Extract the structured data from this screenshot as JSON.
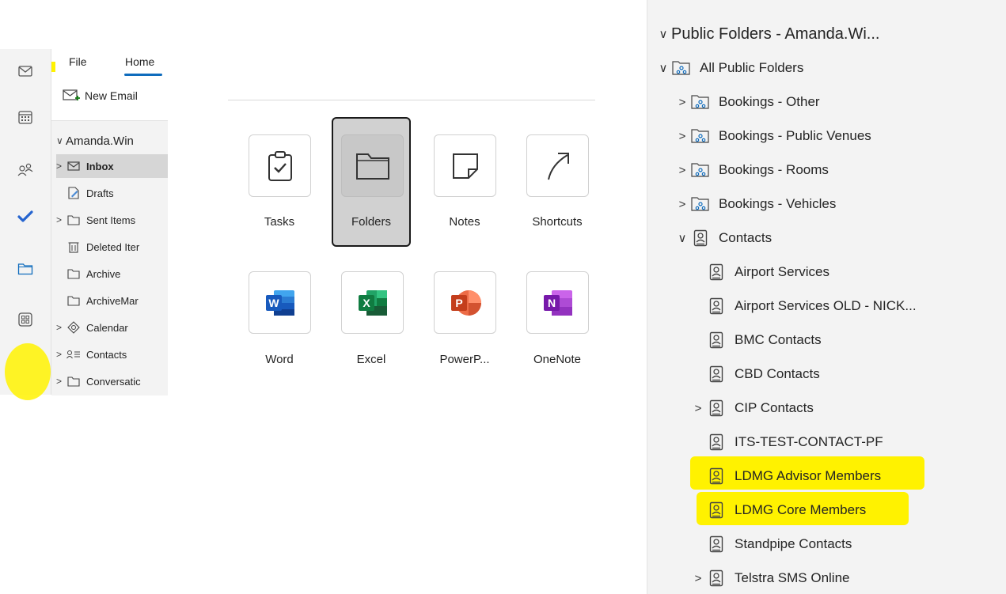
{
  "outlook": {
    "ribbon": {
      "file_tab": "File",
      "home_tab": "Home",
      "new_email": "New Email"
    },
    "nav_rail": [
      "mail-icon",
      "calendar-icon",
      "people-icon",
      "todo-icon",
      "folder-icon",
      "apps-icon"
    ],
    "folder_pane": {
      "account": "Amanda.Win",
      "folders": [
        {
          "label": "Inbox",
          "icon": "inbox-icon",
          "expandable": true,
          "selected": true
        },
        {
          "label": "Drafts",
          "icon": "drafts-icon",
          "expandable": false
        },
        {
          "label": "Sent Items",
          "icon": "folder-icon",
          "expandable": true
        },
        {
          "label": "Deleted Iter",
          "icon": "trash-icon",
          "expandable": false
        },
        {
          "label": "Archive",
          "icon": "folder-icon",
          "expandable": false
        },
        {
          "label": "ArchiveMar",
          "icon": "folder-icon",
          "expandable": false
        },
        {
          "label": "Calendar",
          "icon": "calendar-icon",
          "expandable": true
        },
        {
          "label": "Contacts",
          "icon": "contacts-icon",
          "expandable": true
        },
        {
          "label": "Conversatic",
          "icon": "folder-icon",
          "expandable": true
        }
      ]
    }
  },
  "launcher": {
    "apps_row1": [
      {
        "label": "Tasks",
        "icon": "tasks-icon"
      },
      {
        "label": "Folders",
        "icon": "folder-icon",
        "selected": true
      },
      {
        "label": "Notes",
        "icon": "notes-icon"
      },
      {
        "label": "Shortcuts",
        "icon": "shortcut-icon"
      }
    ],
    "apps_row2": [
      {
        "label": "Word",
        "icon": "word-icon",
        "color": "#185abd"
      },
      {
        "label": "Excel",
        "icon": "excel-icon",
        "color": "#107c41"
      },
      {
        "label": "PowerP...",
        "icon": "powerpoint-icon",
        "color": "#c43e1c"
      },
      {
        "label": "OneNote",
        "icon": "onenote-icon",
        "color": "#7719aa"
      }
    ]
  },
  "public_folders": {
    "title": "Public Folders - Amanda.Wi...",
    "all": "All Public Folders",
    "items": [
      {
        "label": "Bookings - Other",
        "type": "public-folder",
        "expandable": true
      },
      {
        "label": "Bookings - Public Venues",
        "type": "public-folder",
        "expandable": true
      },
      {
        "label": "Bookings - Rooms",
        "type": "public-folder",
        "expandable": true
      },
      {
        "label": "Bookings - Vehicles",
        "type": "public-folder",
        "expandable": true
      },
      {
        "label": "Contacts",
        "type": "contact-folder",
        "expandable": true,
        "expanded": true
      },
      {
        "label": "Airport Services",
        "type": "contact-folder",
        "child": true
      },
      {
        "label": "Airport Services OLD - NICK...",
        "type": "contact-folder",
        "child": true
      },
      {
        "label": "BMC Contacts",
        "type": "contact-folder",
        "child": true
      },
      {
        "label": "CBD Contacts",
        "type": "contact-folder",
        "child": true
      },
      {
        "label": "CIP Contacts",
        "type": "contact-folder",
        "child": true,
        "expandable": true
      },
      {
        "label": "ITS-TEST-CONTACT-PF",
        "type": "contact-folder",
        "child": true
      },
      {
        "label": "LDMG Advisor Members",
        "type": "contact-folder",
        "child": true,
        "highlighted": true
      },
      {
        "label": "LDMG Core Members",
        "type": "contact-folder",
        "child": true,
        "highlighted": true
      },
      {
        "label": "Standpipe Contacts",
        "type": "contact-folder",
        "child": true
      },
      {
        "label": "Telstra SMS Online",
        "type": "contact-folder",
        "child": true,
        "expandable": true
      }
    ]
  },
  "colors": {
    "accent": "#0f6cbd",
    "highlight": "#fff200",
    "todo": "#2564cf"
  }
}
